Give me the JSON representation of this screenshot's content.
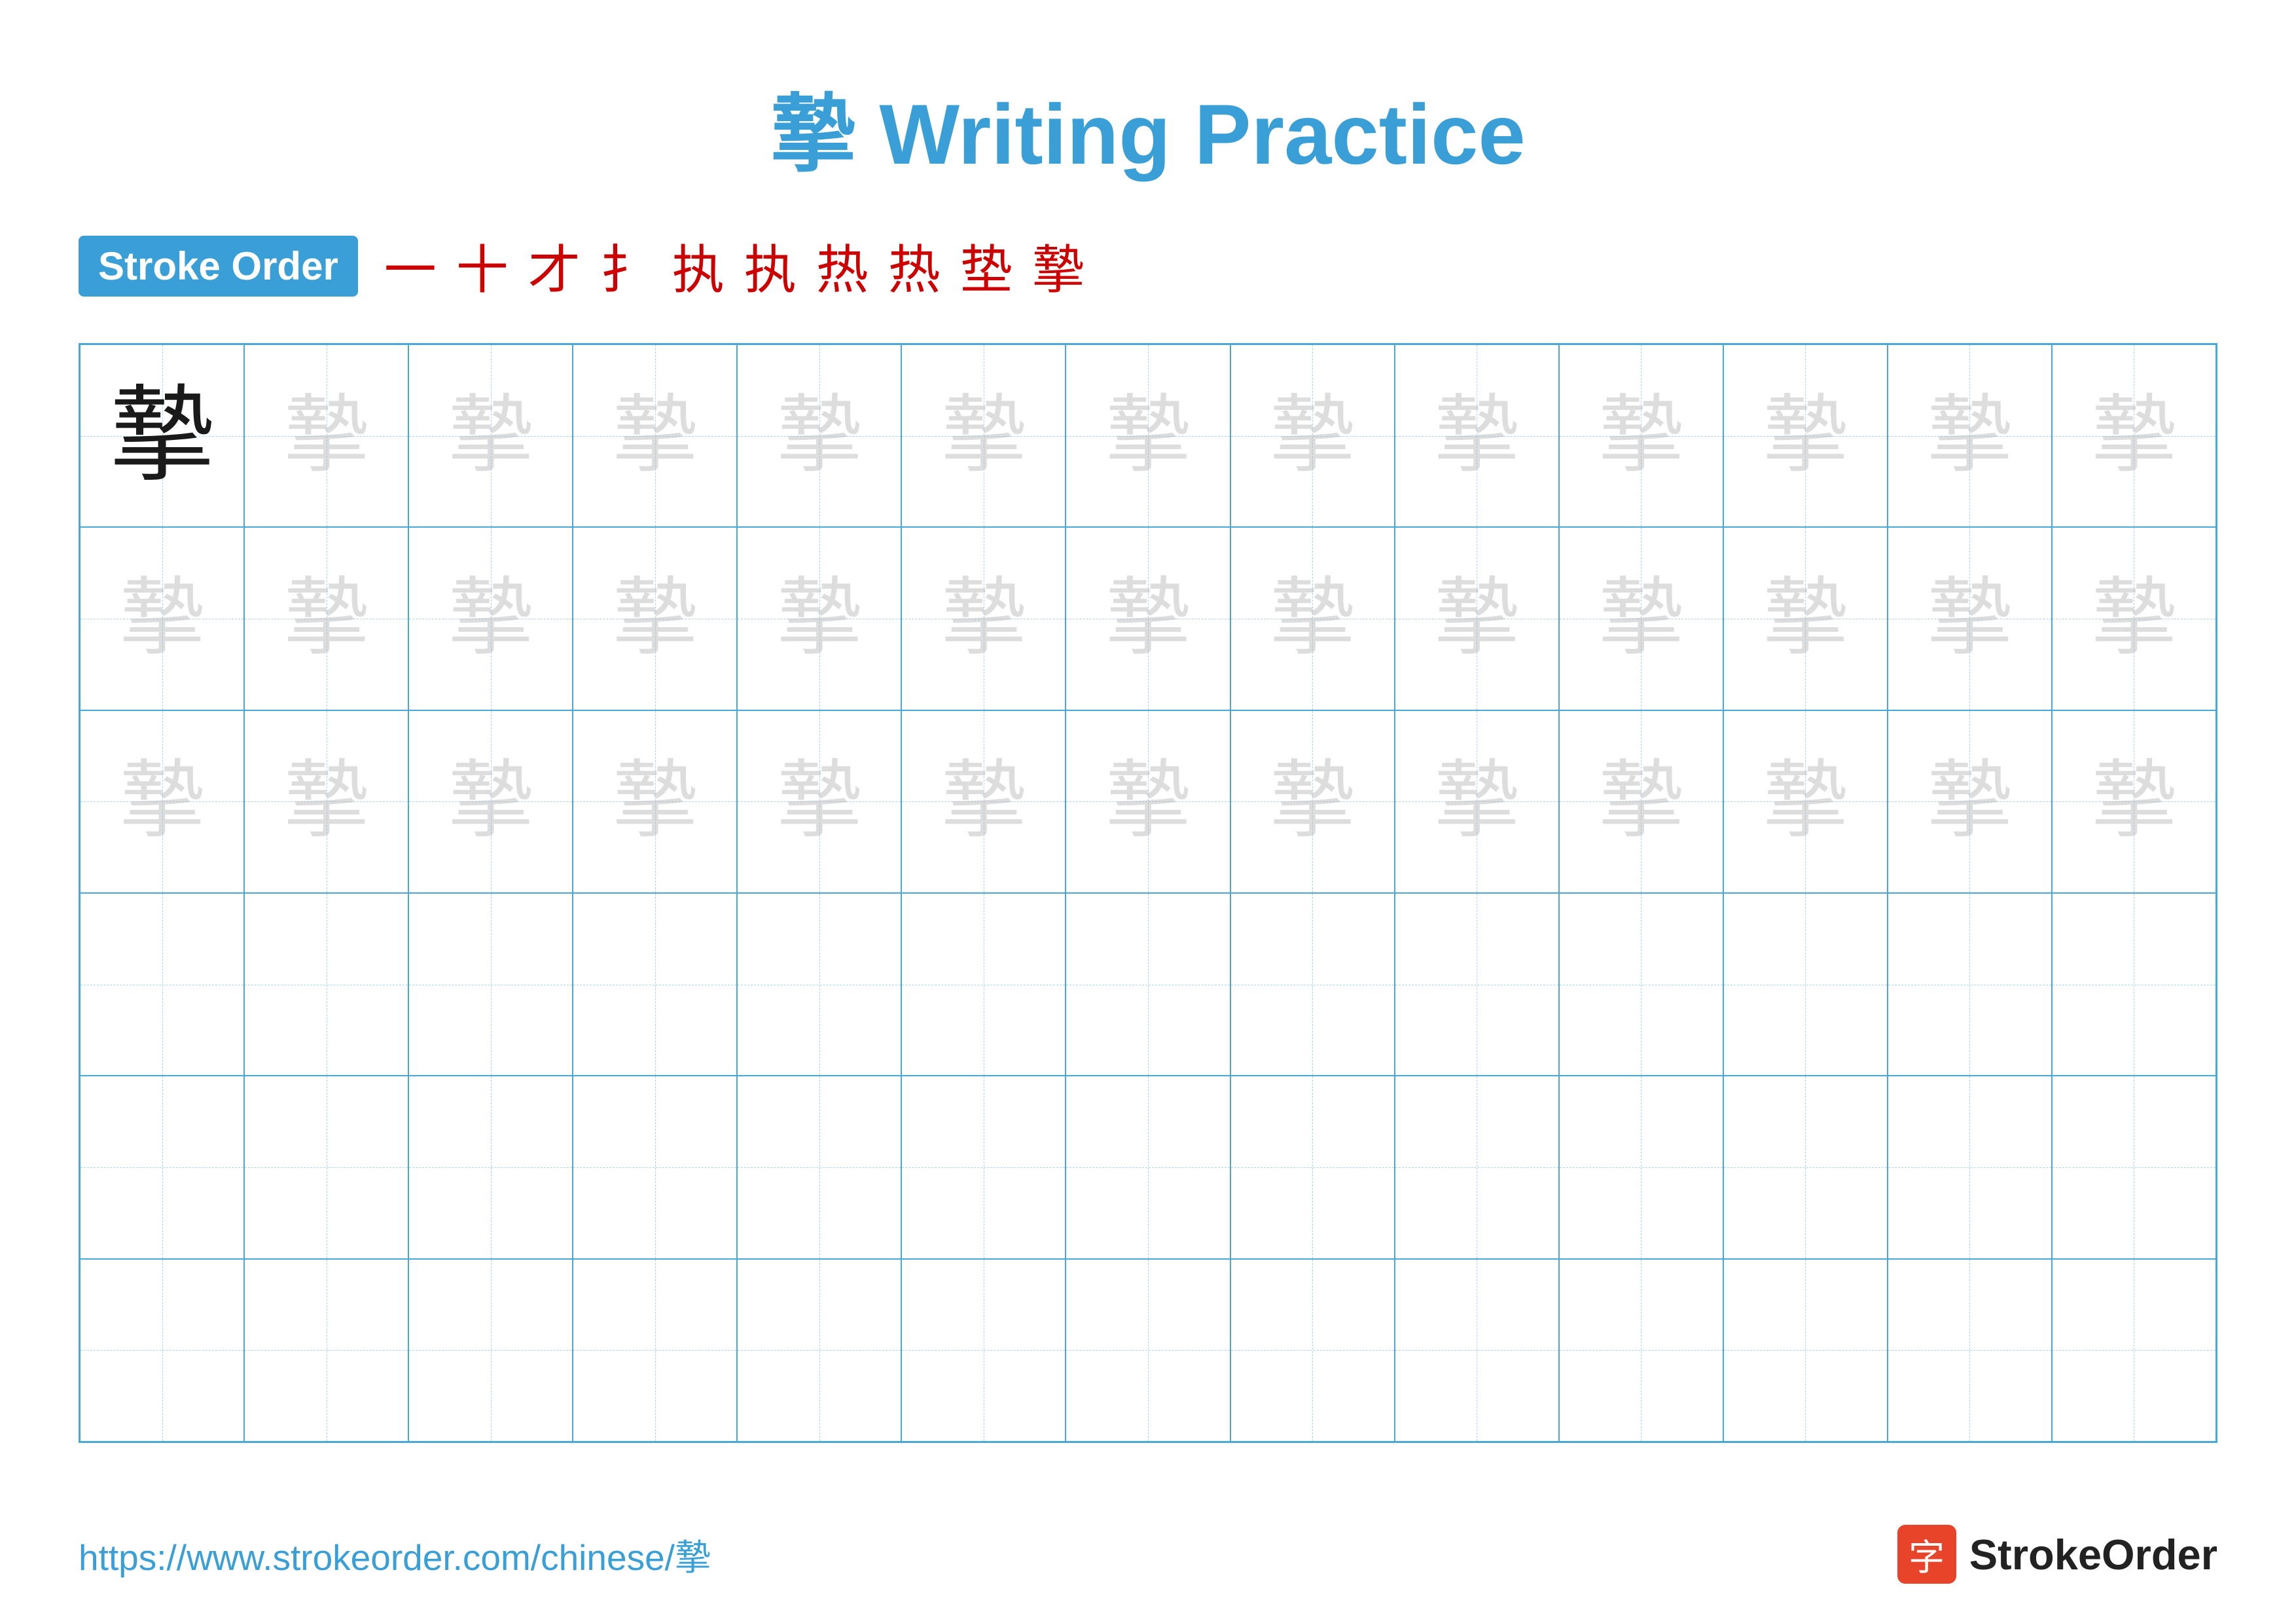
{
  "title": "摯 Writing Practice",
  "stroke_order": {
    "badge_label": "Stroke Order",
    "steps": [
      "一",
      "十",
      "才",
      "扌",
      "执",
      "执",
      "热",
      "热",
      "垫",
      "摯"
    ]
  },
  "character": "摯",
  "grid": {
    "rows": 6,
    "cols": 13
  },
  "footer": {
    "url": "https://www.strokeorder.com/chinese/摯",
    "logo_char": "字",
    "logo_text": "StrokeOrder"
  }
}
